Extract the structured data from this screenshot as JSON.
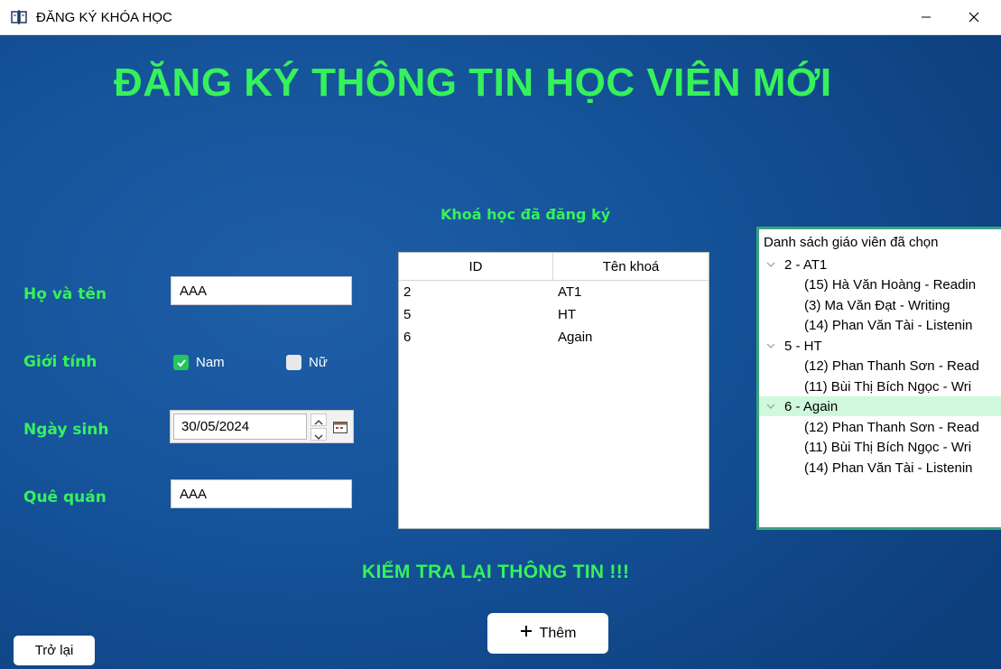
{
  "window": {
    "title": "ĐĂNG KÝ KHÓA HỌC",
    "minimize_icon": "minimize-icon",
    "close_icon": "close-icon"
  },
  "heading": "ĐĂNG KÝ THÔNG TIN HỌC VIÊN MỚI",
  "form": {
    "name_label": "Họ và tên",
    "name_value": "AAA",
    "gender_label": "Giới tính",
    "gender_male": "Nam",
    "gender_male_checked": true,
    "gender_female": "Nữ",
    "gender_female_checked": false,
    "dob_label": "Ngày sinh",
    "dob_value": "30/05/2024",
    "hometown_label": "Quê quán",
    "hometown_value": "AAA"
  },
  "courses": {
    "title": "Khoá học đã đăng ký",
    "columns": [
      "ID",
      "Tên khoá"
    ],
    "rows": [
      [
        "2",
        "AT1"
      ],
      [
        "5",
        "HT"
      ],
      [
        "6",
        "Again"
      ]
    ]
  },
  "teachers": {
    "root": "Danh sách giáo viên đã chọn",
    "groups": [
      {
        "label": "2 - AT1",
        "selected": false,
        "items": [
          "(15) Hà Văn Hoàng - Readin",
          "(3) Ma Văn Đạt - Writing",
          "(14) Phan Văn Tài - Listenin"
        ]
      },
      {
        "label": "5 - HT",
        "selected": false,
        "items": [
          "(12) Phan Thanh Sơn - Read",
          "(11) Bùi Thị Bích Ngọc - Wri"
        ]
      },
      {
        "label": "6 - Again",
        "selected": true,
        "items": [
          "(12) Phan Thanh Sơn - Read",
          "(11) Bùi Thị Bích Ngọc - Wri",
          "(14) Phan Văn Tài - Listenin"
        ]
      }
    ]
  },
  "check_message": "KIỂM TRA LẠI THÔNG TIN !!!",
  "buttons": {
    "add": "Thêm",
    "back": "Trở lại"
  },
  "colors": {
    "accent_green": "#35f25b",
    "background_blue": "#15539a",
    "tree_border": "#3aa37b",
    "tree_selected": "#cff8dc"
  }
}
